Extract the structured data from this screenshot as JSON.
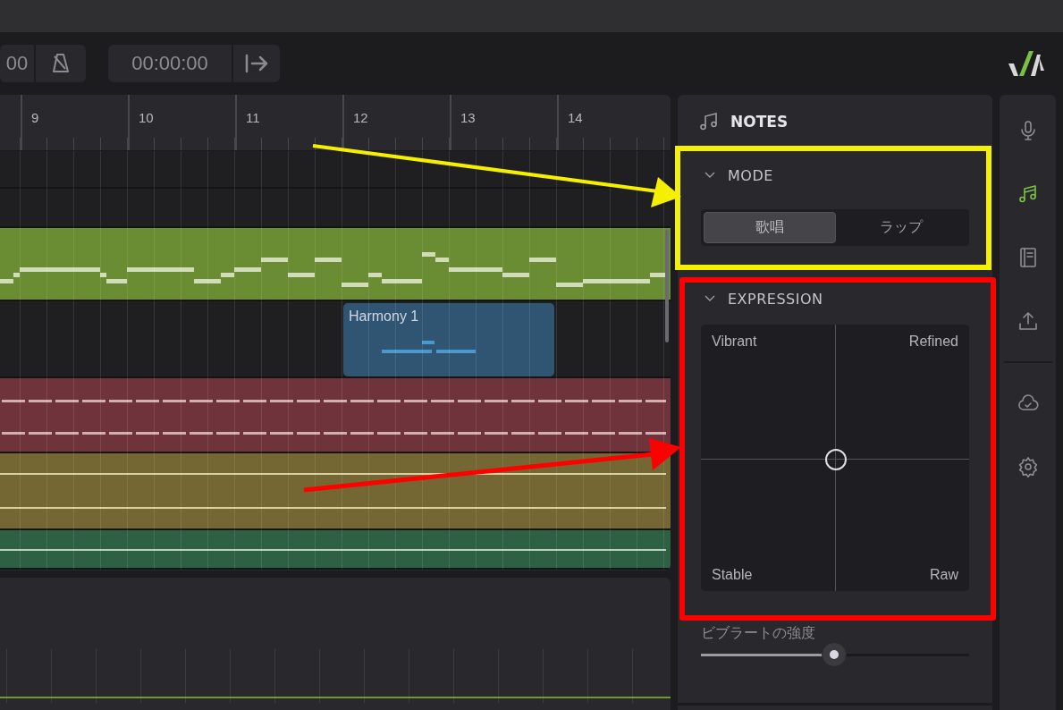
{
  "toolbar": {
    "tempo_fragment": "00",
    "time": "00:00:00"
  },
  "ruler": {
    "bars": [
      "9",
      "10",
      "11",
      "12",
      "13",
      "14"
    ]
  },
  "tracks": [
    {
      "kind": "empty",
      "color": "#1f1f22"
    },
    {
      "kind": "empty",
      "color": "#1f1f22"
    },
    {
      "kind": "melody",
      "color": "#6a8c32"
    },
    {
      "kind": "clip",
      "color": "#1f1f22",
      "clip": {
        "label": "Harmony 1",
        "color": "#2f5572"
      }
    },
    {
      "kind": "dashes",
      "color": "#6f333b"
    },
    {
      "kind": "lines",
      "color": "#746733"
    },
    {
      "kind": "line",
      "color": "#2e6043"
    }
  ],
  "notes_panel": {
    "title": "NOTES",
    "mode": {
      "title": "MODE",
      "expanded": true,
      "options": [
        {
          "label": "歌唱",
          "selected": true
        },
        {
          "label": "ラップ",
          "selected": false
        }
      ]
    },
    "expression": {
      "title": "EXPRESSION",
      "expanded": true,
      "top_left": "Vibrant",
      "top_right": "Refined",
      "bottom_left": "Stable",
      "bottom_right": "Raw"
    },
    "vibrato": {
      "label": "ビブラートの強度",
      "level": 0.5
    }
  },
  "sidebar": {
    "items": [
      {
        "kind": "microphone",
        "selected": false
      },
      {
        "kind": "music",
        "selected": true
      },
      {
        "kind": "book",
        "selected": false
      },
      {
        "kind": "upload",
        "selected": false
      },
      {
        "kind": "divider"
      },
      {
        "kind": "cloud",
        "selected": false
      },
      {
        "kind": "settings",
        "selected": false
      }
    ]
  }
}
